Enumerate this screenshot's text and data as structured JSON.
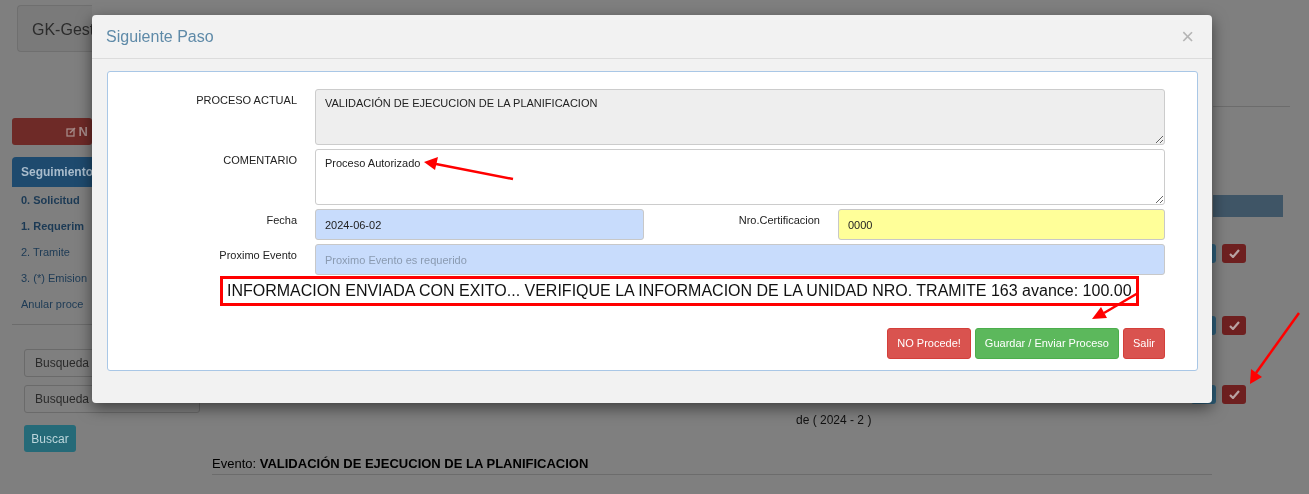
{
  "app_title": "GK-Gest",
  "new_button": "N",
  "sidebar": {
    "header": "Seguimiento",
    "items": [
      {
        "label": "0. Solicitud",
        "highlighted": true
      },
      {
        "label": "1. Requerim",
        "highlighted": true
      },
      {
        "label": "2. Tramite",
        "highlighted": false
      },
      {
        "label": "3. (*) Emision",
        "highlighted": false
      },
      {
        "label": "Anular proce",
        "highlighted": false
      }
    ]
  },
  "search_fields": [
    {
      "placeholder": "Busqueda"
    },
    {
      "placeholder": "Busqueda"
    }
  ],
  "search_button": "Buscar",
  "table_row": {
    "description_tail": "de ( 2024 - 2 )"
  },
  "event": {
    "label": "Evento:",
    "value": "VALIDACIÓN DE EJECUCION DE LA PLANIFICACION"
  },
  "modal": {
    "title": "Siguiente Paso",
    "close": "×",
    "fields": [
      {
        "kind": "textarea",
        "label": "PROCESO ACTUAL",
        "value": "VALIDACIÓN DE EJECUCION DE LA PLANIFICACION",
        "disabled": true
      },
      {
        "kind": "textarea",
        "label": "COMENTARIO",
        "value": "Proceso Autorizado",
        "disabled": false
      }
    ],
    "date": {
      "label": "Fecha",
      "value": "2024-06-02"
    },
    "certification": {
      "label": "Nro.Certificacion",
      "value": "0000"
    },
    "next_event": {
      "label": "Proximo Evento",
      "placeholder": "Proximo Evento es requerido"
    },
    "message": "INFORMACION ENVIADA CON EXITO... VERIFIQUE LA INFORMACION DE LA UNIDAD NRO. TRAMITE 163 avance: 100.00",
    "buttons": [
      {
        "label": "NO Procede!",
        "kind": "danger"
      },
      {
        "label": "Guardar / Enviar Proceso",
        "kind": "success"
      },
      {
        "label": "Salir",
        "kind": "danger"
      }
    ]
  }
}
